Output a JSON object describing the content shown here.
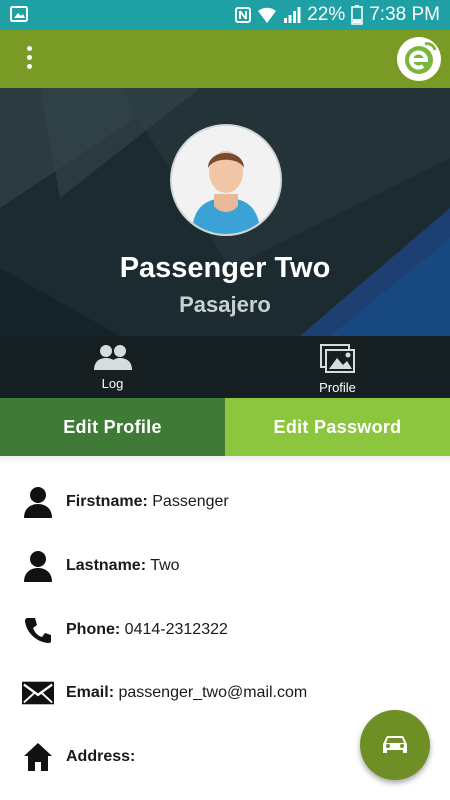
{
  "status_bar": {
    "battery": "22%",
    "time": "7:38 PM"
  },
  "app_bar": {
    "menu_icon": "more-vert-icon",
    "logo_icon": "app-logo-icon"
  },
  "profile": {
    "name": "Passenger Two",
    "role": "Pasajero"
  },
  "tabs": [
    {
      "label": "Log",
      "icon": "people-icon"
    },
    {
      "label": "Profile",
      "icon": "photos-icon"
    }
  ],
  "buttons": {
    "edit_profile": "Edit Profile",
    "edit_password": "Edit Password"
  },
  "info": [
    {
      "label": "Firstname:",
      "value": "Passenger",
      "icon": "person-icon"
    },
    {
      "label": "Lastname:",
      "value": "Two",
      "icon": "person-icon"
    },
    {
      "label": "Phone:",
      "value": "0414-2312322",
      "icon": "phone-icon"
    },
    {
      "label": "Email:",
      "value": "passenger_two@mail.com",
      "icon": "mail-icon"
    },
    {
      "label": "Address:",
      "value": "",
      "icon": "home-icon"
    }
  ],
  "fab": {
    "icon": "car-icon"
  },
  "colors": {
    "status_bar": "#1ea0a5",
    "app_bar": "#7a9a26",
    "edit_profile": "#3f7a37",
    "edit_password": "#8cc63f",
    "fab": "#6e8f25"
  }
}
